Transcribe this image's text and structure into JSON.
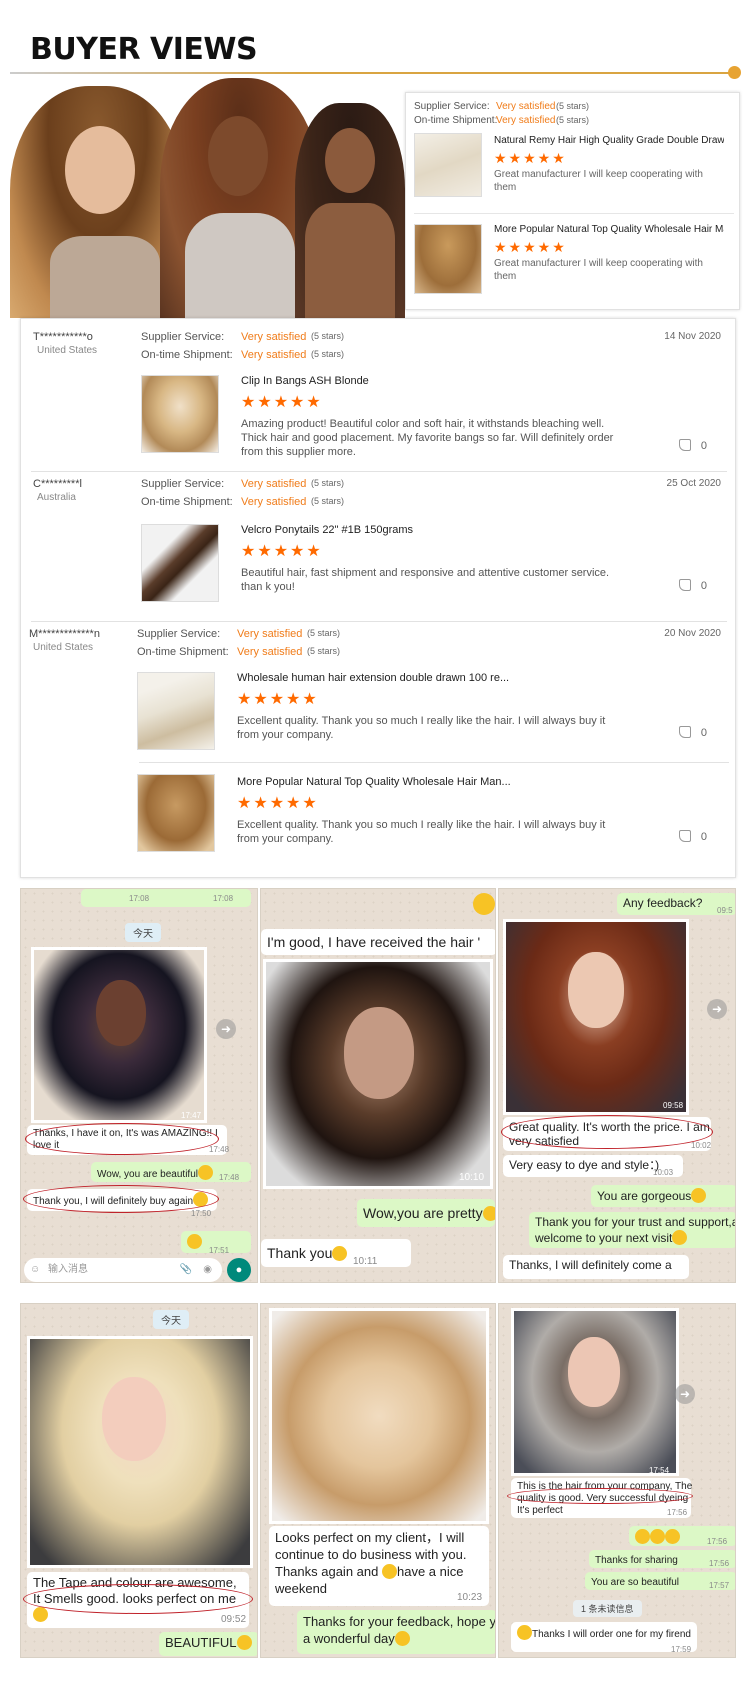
{
  "header": {
    "title": "BUYER VIEWS"
  },
  "supplier_card": {
    "service_label": "Supplier Service:",
    "service_value": "Very satisfied",
    "service_stars": "(5 stars)",
    "shipment_label": "On-time Shipment:",
    "shipment_value": "Very satisfied",
    "shipment_stars": "(5 stars)",
    "products": [
      {
        "name": "Natural Remy Hair High Quality Grade Double Drawn L...",
        "stars": "★★★★★",
        "comment": "Great manufacturer I will keep cooperating with them"
      },
      {
        "name": "More Popular Natural Top Quality Wholesale Hair Man...",
        "stars": "★★★★★",
        "comment": "Great manufacturer I will keep cooperating with them"
      }
    ]
  },
  "reviews": [
    {
      "buyer": "T***********o",
      "country": "United States",
      "date": "14 Nov 2020",
      "service_label": "Supplier Service:",
      "service_value": "Very satisfied",
      "service_stars": "(5 stars)",
      "shipment_label": "On-time Shipment:",
      "shipment_value": "Very satisfied",
      "shipment_stars": "(5 stars)",
      "items": [
        {
          "name": "Clip In Bangs ASH Blonde",
          "stars": "★★★★★",
          "comment": "Amazing product! Beautiful color and soft hair, it withstands bleaching well. Thick hair and good placement. My favorite bangs so far. Will definitely order from this supplier more.",
          "likes": "0"
        }
      ]
    },
    {
      "buyer": "C*********l",
      "country": "Australia",
      "date": "25 Oct 2020",
      "service_label": "Supplier Service:",
      "service_value": "Very satisfied",
      "service_stars": "(5 stars)",
      "shipment_label": "On-time Shipment:",
      "shipment_value": "Very satisfied",
      "shipment_stars": "(5 stars)",
      "items": [
        {
          "name": "Velcro Ponytails 22\" #1B 150grams",
          "stars": "★★★★★",
          "comment": "Beautiful hair, fast shipment and responsive and attentive customer service. than k you!",
          "likes": "0"
        }
      ]
    },
    {
      "buyer": "M*************n",
      "country": "United States",
      "date": "20 Nov 2020",
      "service_label": "Supplier Service:",
      "service_value": "Very satisfied",
      "service_stars": "(5 stars)",
      "shipment_label": "On-time Shipment:",
      "shipment_value": "Very satisfied",
      "shipment_stars": "(5 stars)",
      "items": [
        {
          "name": "Wholesale human hair extension double drawn 100 re...",
          "stars": "★★★★★",
          "comment": "Excellent quality. Thank you so much I really like the hair. I will always buy it from your company.",
          "likes": "0"
        },
        {
          "name": "More Popular Natural Top Quality Wholesale Hair Man...",
          "stars": "★★★★★",
          "comment": "Excellent quality. Thank you so much I really like the hair. I will always buy it from your company.",
          "likes": "0"
        }
      ]
    }
  ],
  "chats_row1": {
    "c1": {
      "top_time_a": "17:08",
      "top_time_b": "17:08",
      "date_chip": "今天",
      "photo_time": "17:47",
      "msg1": "Thanks, I have it on, It's was AMAZING!! I",
      "msg1b": "love it",
      "msg1_time": "17:48",
      "msg2": "Wow, you are beautiful",
      "msg2_time": "17:48",
      "msg3": "Thank you, I will definitely buy again",
      "msg3_time": "17:50",
      "msg4_time": "17:51",
      "input_placeholder": "输入消息"
    },
    "c2": {
      "msg1": "I'm good, I have received the hair '",
      "msg1_time": "10",
      "photo_time": "10:10",
      "msg2": "Wow,you are pretty",
      "msg3": "Thank you",
      "msg3_time": "10:11"
    },
    "c3": {
      "msg1": "Any feedback?",
      "msg1_time": "09:5",
      "photo_time": "09:58",
      "msg2": "Great quality. It's worth the price. I am",
      "msg2b": "very satisfied",
      "msg2_time": "10:02",
      "msg3": "Very easy to dye and style：)",
      "msg3_time": "10:03",
      "msg4": "You are gorgeous",
      "msg5": "Thank you for your trust and support,a",
      "msg5b": "welcome to your next visit",
      "msg6": "Thanks, I will definitely come a"
    }
  },
  "chats_row2": {
    "c1": {
      "date_chip": "今天",
      "msg1": "The Tape and colour are awesome,",
      "msg1b": "It Smells good. looks perfect on me",
      "msg1_time": "09:52",
      "msg2": "BEAUTIFUL"
    },
    "c2": {
      "msg1": "Looks perfect on my client，I will",
      "msg1b": "continue to do business with you.",
      "msg1c": "Thanks again and",
      "msg1d": "have a nice",
      "msg1e": "weekend",
      "msg1_time": "10:23",
      "msg2": "Thanks for your feedback, hope y",
      "msg2b": "a wonderful day"
    },
    "c3": {
      "photo_time": "17:54",
      "msg1": "This is the hair from your company, The",
      "msg1b": "quality is good. Very successful dyeing",
      "msg1c": "It's perfect",
      "msg1_time": "17:56",
      "emoji_time": "17:56",
      "msg2": "Thanks for sharing",
      "msg2_time": "17:56",
      "msg3": "You are so beautiful",
      "msg3_time": "17:57",
      "unread_chip": "1 条未读信息",
      "msg4": "Thanks I will order one for my firend",
      "msg4_time": "17:59"
    }
  }
}
